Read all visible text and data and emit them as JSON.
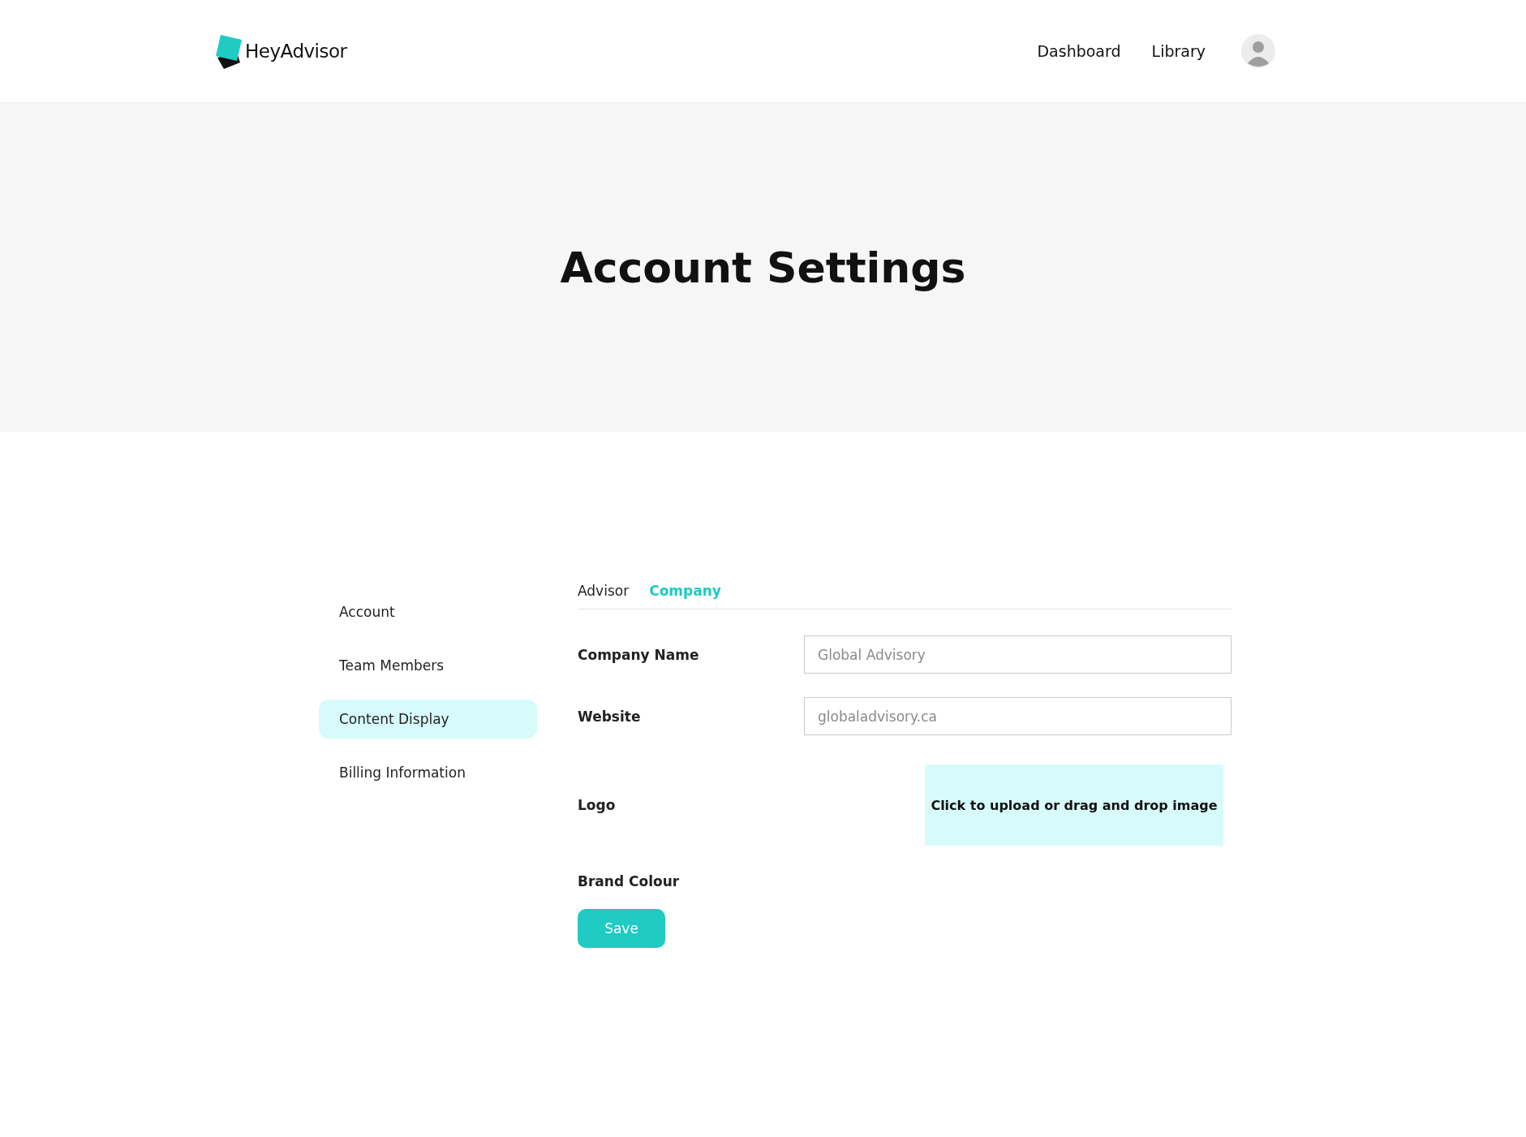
{
  "header": {
    "brand": "HeyAdvisor",
    "nav": [
      {
        "label": "Dashboard"
      },
      {
        "label": "Library"
      }
    ]
  },
  "hero": {
    "title": "Account Settings"
  },
  "sidebar": {
    "items": [
      {
        "label": "Account",
        "selected": false
      },
      {
        "label": "Team Members",
        "selected": false
      },
      {
        "label": "Content Display",
        "selected": true
      },
      {
        "label": "Billing Information",
        "selected": false
      }
    ]
  },
  "tabs": [
    {
      "label": "Advisor",
      "selected": false
    },
    {
      "label": "Company",
      "selected": true
    }
  ],
  "form": {
    "fields": [
      {
        "kind": "text",
        "label": "Company Name",
        "placeholder": "Global Advisory"
      },
      {
        "kind": "text",
        "label": "Website",
        "placeholder": "globaladvisory.ca"
      },
      {
        "kind": "upload",
        "label": "Logo",
        "prompt": "Click to upload or drag and drop image"
      },
      {
        "kind": "color",
        "label": "Brand Colour"
      }
    ],
    "save": "Save"
  }
}
